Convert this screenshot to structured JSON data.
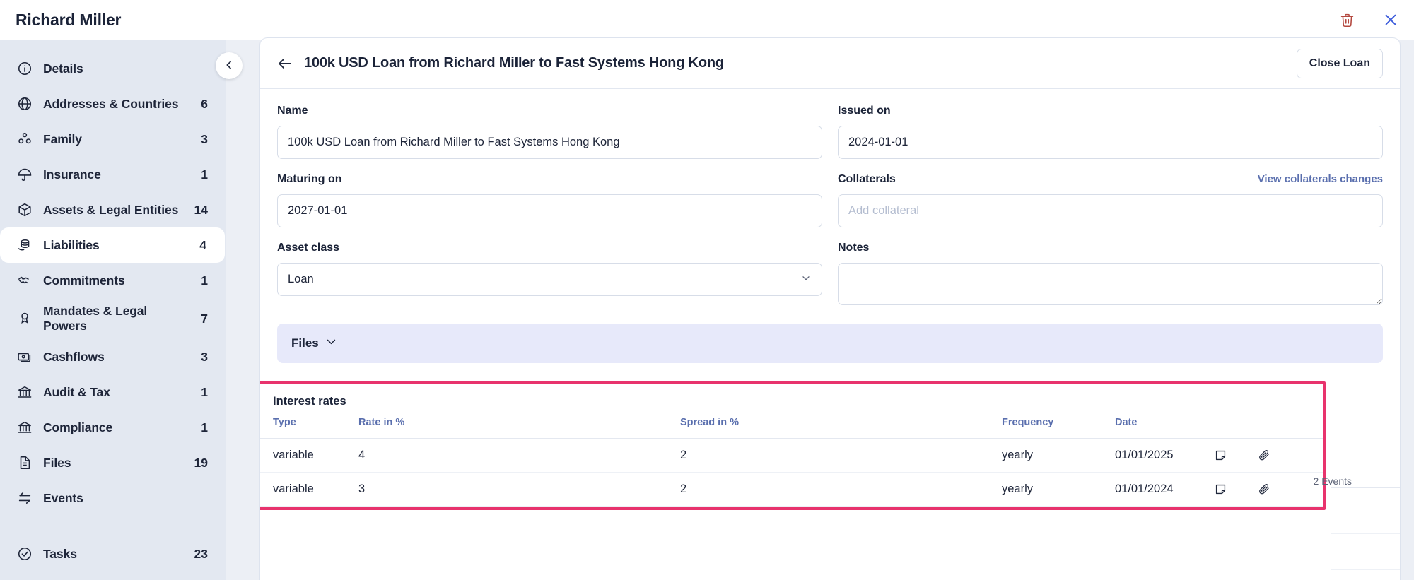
{
  "topbar": {
    "title": "Richard Miller",
    "delete_icon": "trash-icon",
    "close_icon": "close-icon",
    "delete_color": "#b4483f",
    "close_color": "#3b5bdb"
  },
  "sidebar": {
    "collapse_label": "chevron-left-icon",
    "items": [
      {
        "label": "Details",
        "count": "",
        "icon": "info-icon",
        "active": false
      },
      {
        "label": "Addresses & Countries",
        "count": "6",
        "icon": "globe-icon",
        "active": false
      },
      {
        "label": "Family",
        "count": "3",
        "icon": "family-icon",
        "active": false
      },
      {
        "label": "Insurance",
        "count": "1",
        "icon": "umbrella-icon",
        "active": false
      },
      {
        "label": "Assets & Legal Entities",
        "count": "14",
        "icon": "box-icon",
        "active": false
      },
      {
        "label": "Liabilities",
        "count": "4",
        "icon": "coins-icon",
        "active": true
      },
      {
        "label": "Commitments",
        "count": "1",
        "icon": "handshake-icon",
        "active": false
      },
      {
        "label": "Mandates & Legal Powers",
        "count": "7",
        "icon": "person-badge-icon",
        "active": false
      },
      {
        "label": "Cashflows",
        "count": "3",
        "icon": "banknote-icon",
        "active": false
      },
      {
        "label": "Audit & Tax",
        "count": "1",
        "icon": "bank-icon",
        "active": false
      },
      {
        "label": "Compliance",
        "count": "1",
        "icon": "bank-icon",
        "active": false
      },
      {
        "label": "Files",
        "count": "19",
        "icon": "document-icon",
        "active": false
      },
      {
        "label": "Events",
        "count": "",
        "icon": "transfer-icon",
        "active": false
      }
    ],
    "footer_items": [
      {
        "label": "Tasks",
        "count": "23",
        "icon": "check-circle-icon",
        "active": false
      }
    ]
  },
  "panel": {
    "back_icon": "arrow-left-icon",
    "title": "100k USD Loan from Richard Miller to Fast Systems Hong Kong",
    "close_loan_label": "Close Loan"
  },
  "form": {
    "name": {
      "label": "Name",
      "value": "100k USD Loan from Richard Miller to Fast Systems Hong Kong"
    },
    "issued_on": {
      "label": "Issued on",
      "value": "2024-01-01"
    },
    "maturing_on": {
      "label": "Maturing on",
      "value": "2027-01-01"
    },
    "collaterals": {
      "label": "Collaterals",
      "placeholder": "Add collateral",
      "value": "",
      "link": "View collaterals changes"
    },
    "asset_class": {
      "label": "Asset class",
      "value": "Loan",
      "options": [
        "Loan"
      ]
    },
    "notes": {
      "label": "Notes",
      "value": ""
    }
  },
  "files_section": {
    "label": "Files",
    "chevron": "chevron-down-icon"
  },
  "interest_rates": {
    "title": "Interest rates",
    "events_label": "2 Events",
    "columns": [
      "Type",
      "Rate in %",
      "Spread in %",
      "Frequency",
      "Date"
    ],
    "rows": [
      {
        "type": "variable",
        "rate": "4",
        "spread": "2",
        "frequency": "yearly",
        "date": "01/01/2025",
        "note_icon": "note-icon",
        "attach_icon": "paperclip-icon"
      },
      {
        "type": "variable",
        "rate": "3",
        "spread": "2",
        "frequency": "yearly",
        "date": "01/01/2024",
        "note_icon": "note-icon",
        "attach_icon": "paperclip-icon"
      }
    ],
    "highlight_color": "#e8336d"
  }
}
